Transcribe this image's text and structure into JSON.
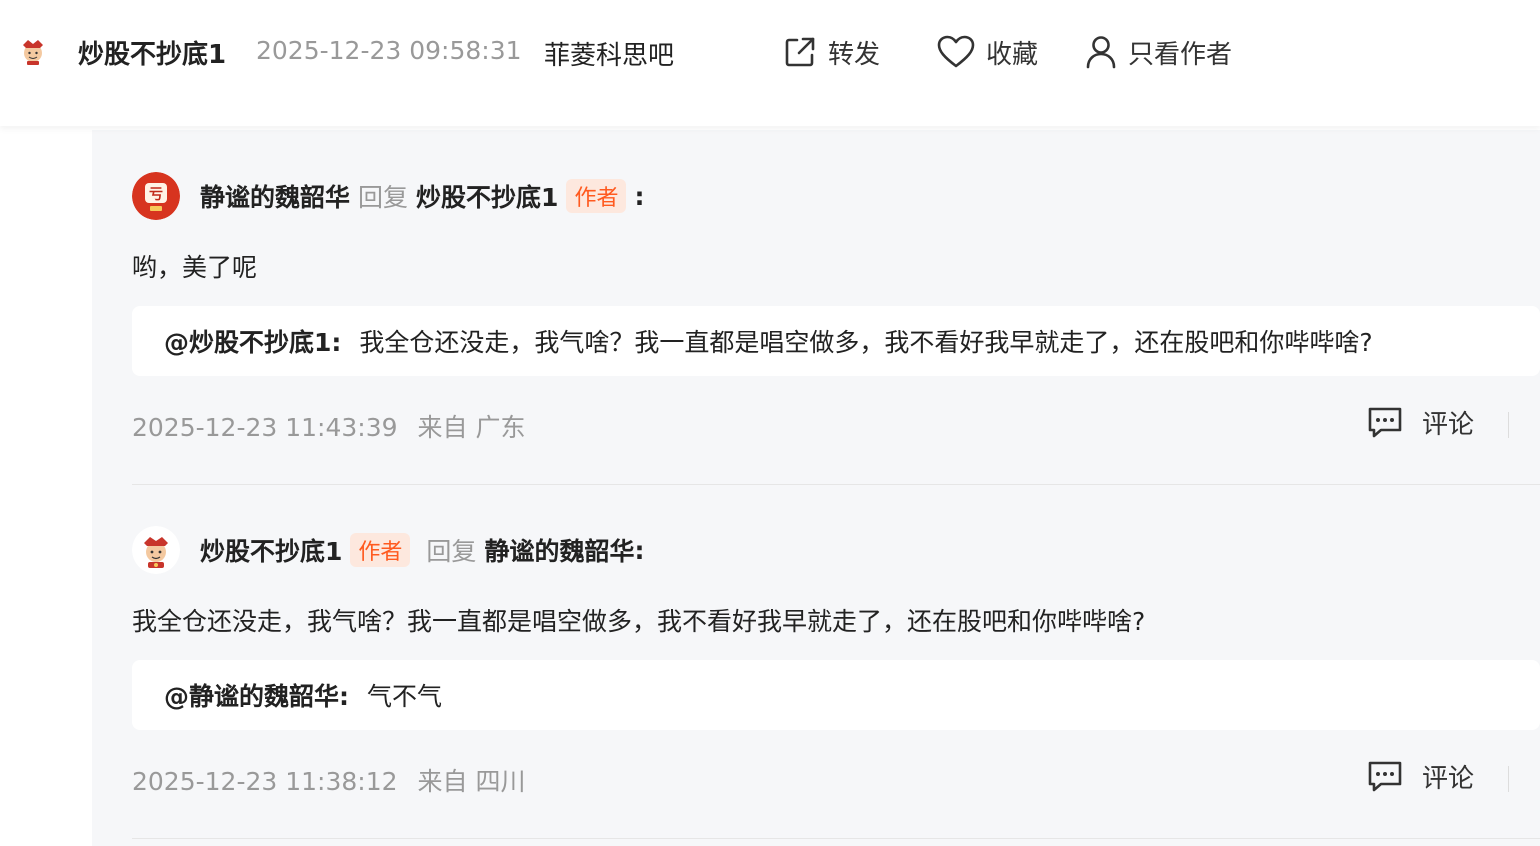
{
  "header": {
    "author_name": "炒股不抄底1",
    "post_time": "2025-12-23 09:58:31",
    "forum_name": "菲菱科思吧",
    "actions": {
      "forward": "转发",
      "favorite": "收藏",
      "only_author": "只看作者"
    }
  },
  "replies": [
    {
      "user": "静谧的魏韶华",
      "reply_word": "回复",
      "target": "炒股不抄底1",
      "author_tag": "作者",
      "colon": ":",
      "body": "哟，美了呢",
      "quote_user": "@炒股不抄底1:",
      "quote_text": "我全仓还没走，我气啥？我一直都是唱空做多，我不看好我早就走了，还在股吧和你哔哔啥?",
      "time": "2025-12-23 11:43:39",
      "location": "来自 广东",
      "comment_label": "评论",
      "avatar_char": "亏",
      "avatar_color": "#d7341f"
    },
    {
      "user": "炒股不抄底1",
      "author_tag": "作者",
      "reply_word": "回复",
      "target": "静谧的魏韶华",
      "colon": ":",
      "body": "我全仓还没走，我气啥？我一直都是唱空做多，我不看好我早就走了，还在股吧和你哔哔啥?",
      "quote_user": "@静谧的魏韶华:",
      "quote_text": "气不气",
      "time": "2025-12-23 11:38:12",
      "location": "来自 四川",
      "comment_label": "评论"
    }
  ],
  "colors": {
    "accent_tag_text": "#ff5a1f",
    "accent_tag_bg": "#fde8de",
    "panel_bg": "#f6f7f9",
    "muted_text": "#999999"
  },
  "icons": {
    "forward": "share-out-icon",
    "favorite": "heart-outline-icon",
    "only_author": "person-icon",
    "comment": "chat-bubble-icon"
  }
}
